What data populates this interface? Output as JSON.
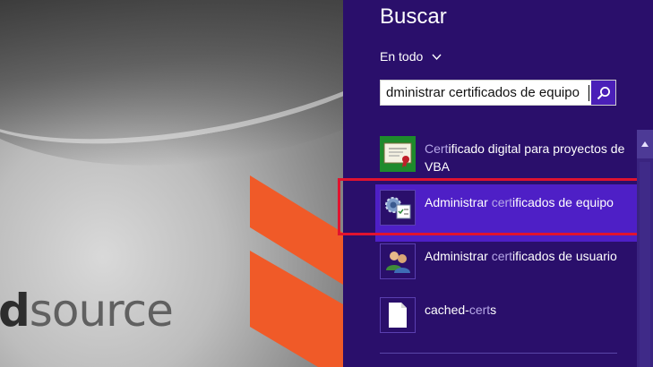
{
  "desktop": {
    "brand": {
      "bold": "d",
      "rest": "source"
    }
  },
  "search": {
    "title": "Buscar",
    "scope": "En todo",
    "query": "dministrar certificados de equipo"
  },
  "results": [
    {
      "pre": "",
      "hl": "Cert",
      "post": "ificado digital para proyectos de VBA",
      "icon": "certificate-icon",
      "selected": false
    },
    {
      "pre": "Administrar ",
      "hl": "cert",
      "post": "ificados de equipo",
      "icon": "computer-certificates-icon",
      "selected": true
    },
    {
      "pre": "Administrar ",
      "hl": "cert",
      "post": "ificados de usuario",
      "icon": "user-certificates-icon",
      "selected": false
    },
    {
      "pre": "cached-",
      "hl": "cert",
      "post": "s",
      "icon": "file-icon",
      "selected": false
    }
  ],
  "colors": {
    "charm_bg": "#2a0f6b",
    "selection_bg": "#4e1fc6",
    "highlight_frame": "#e0132f",
    "search_button": "#4a1fb8",
    "brand_orange": "#f05a28"
  }
}
